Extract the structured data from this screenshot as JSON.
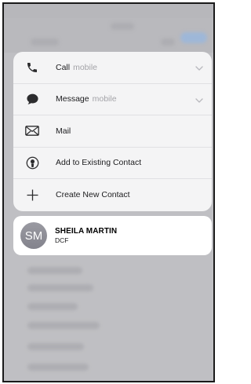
{
  "menu": {
    "items": [
      {
        "label": "Call",
        "sublabel": "mobile",
        "icon": "phone-icon",
        "has_chevron": true
      },
      {
        "label": "Message",
        "sublabel": "mobile",
        "icon": "message-bubble-icon",
        "has_chevron": true
      },
      {
        "label": "Mail",
        "sublabel": "",
        "icon": "mail-envelope-icon",
        "has_chevron": false
      },
      {
        "label": "Add to Existing Contact",
        "sublabel": "",
        "icon": "add-to-contact-icon",
        "has_chevron": false
      },
      {
        "label": "Create New Contact",
        "sublabel": "",
        "icon": "plus-icon",
        "has_chevron": false
      }
    ]
  },
  "contact": {
    "initials": "SM",
    "name": "SHEILA MARTIN",
    "subtitle": "DCF"
  },
  "colors": {
    "menu_background": "#f4f4f5",
    "card_background": "#ffffff",
    "avatar": "#8e8e96",
    "secondary_text": "#a3a3a8"
  }
}
